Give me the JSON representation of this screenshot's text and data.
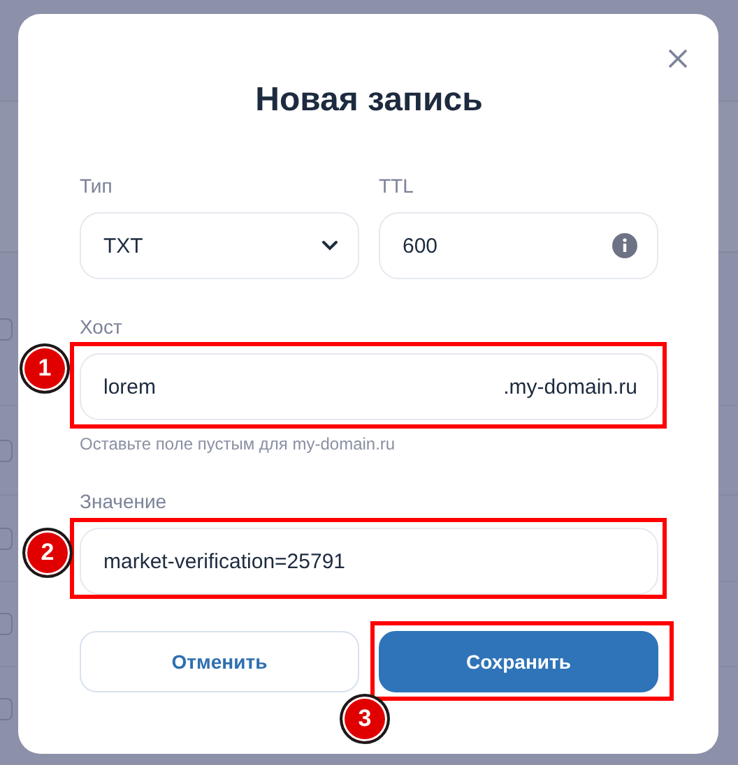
{
  "background": {
    "checkboxes": [
      {
        "checked": false
      },
      {
        "checked": false
      },
      {
        "checked": false
      },
      {
        "checked": false
      },
      {
        "checked": false
      }
    ]
  },
  "dialog": {
    "title": "Новая запись",
    "type_field": {
      "label": "Тип",
      "value": "TXT"
    },
    "ttl_field": {
      "label": "TTL",
      "value": "600"
    },
    "host_field": {
      "label": "Хост",
      "value": "lorem",
      "suffix": ".my-domain.ru",
      "hint": "Оставьте поле пустым для my-domain.ru"
    },
    "value_field": {
      "label": "Значение",
      "value": "market-verification=25791"
    },
    "buttons": [
      {
        "label": "Отменить",
        "kind": "secondary"
      },
      {
        "label": "Сохранить",
        "kind": "primary"
      }
    ]
  },
  "annotations": [
    "1",
    "2",
    "3"
  ]
}
